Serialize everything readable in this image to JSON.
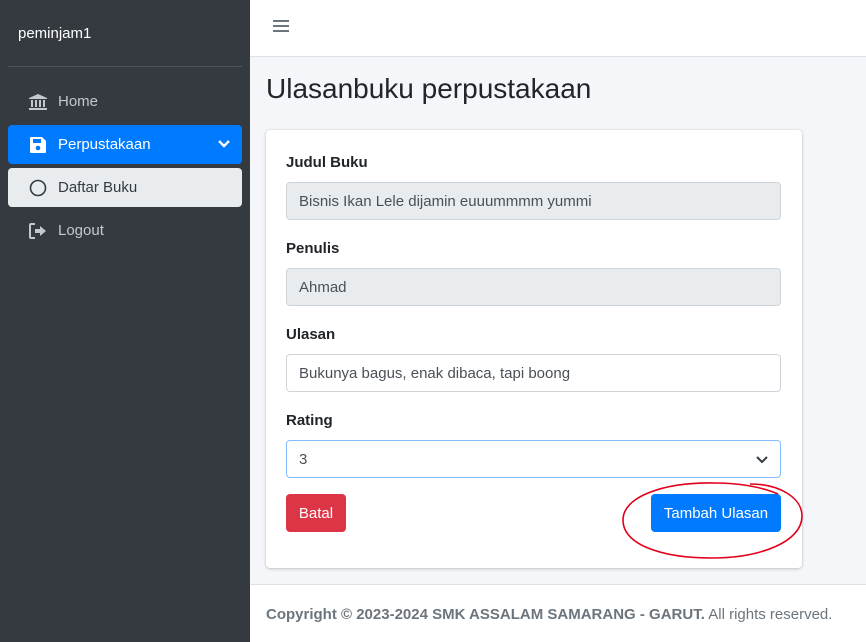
{
  "sidebar": {
    "brand": "peminjam1",
    "items": [
      {
        "label": "Home",
        "icon": "bank-icon"
      },
      {
        "label": "Perpustakaan",
        "icon": "save-icon"
      },
      {
        "label": "Daftar Buku",
        "icon": "circle-icon"
      },
      {
        "label": "Logout",
        "icon": "sign-out-icon"
      }
    ]
  },
  "page": {
    "title": "Ulasanbuku perpustakaan"
  },
  "form": {
    "judul_label": "Judul Buku",
    "judul_value": "Bisnis Ikan Lele dijamin euuummmm yummi",
    "penulis_label": "Penulis",
    "penulis_value": "Ahmad",
    "ulasan_label": "Ulasan",
    "ulasan_value": "Bukunya bagus, enak dibaca, tapi boong",
    "rating_label": "Rating",
    "rating_value": "3",
    "cancel_label": "Batal",
    "submit_label": "Tambah Ulasan"
  },
  "footer": {
    "copyright": "Copyright © 2023-2024 SMK ASSALAM SAMARANG - GARUT.",
    "rights": " All rights reserved."
  },
  "colors": {
    "sidebar_bg": "#343a40",
    "primary": "#007bff",
    "danger": "#dc3545",
    "annotation": "#e0001a"
  }
}
